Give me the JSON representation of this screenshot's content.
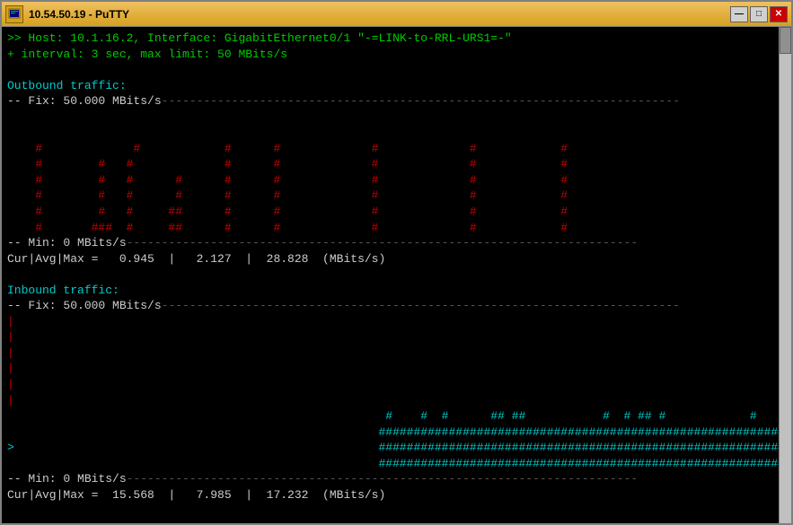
{
  "window": {
    "title": "10.54.50.19 - PuTTY",
    "icon": "🖥"
  },
  "titlebar": {
    "minimize_label": "—",
    "maximize_label": "□",
    "close_label": "✕"
  },
  "terminal": {
    "host_line": ">> Host: 10.1.16.2, Interface: GigabitEthernet0/1 \"-=LINK-to-RRL-URS1=-\"",
    "interval_line": "+ interval: 3 sec, max limit: 50 MBits/s",
    "outbound_header": "Outbound traffic:",
    "outbound_fix": "-- Fix: 50.000 MBits/s",
    "outbound_min": "-- Min: 0 MBits/s",
    "outbound_stats": "Cur|Avg|Max =   0.945  |   2.127  |  28.828  (MBits/s)",
    "inbound_header": "Inbound traffic:",
    "inbound_fix": "-- Fix: 50.000 MBits/s",
    "inbound_min": "-- Min: 0 MBits/s",
    "inbound_stats": "Cur|Avg|Max =  15.568  |   7.985  |  17.232  (MBits/s)"
  }
}
